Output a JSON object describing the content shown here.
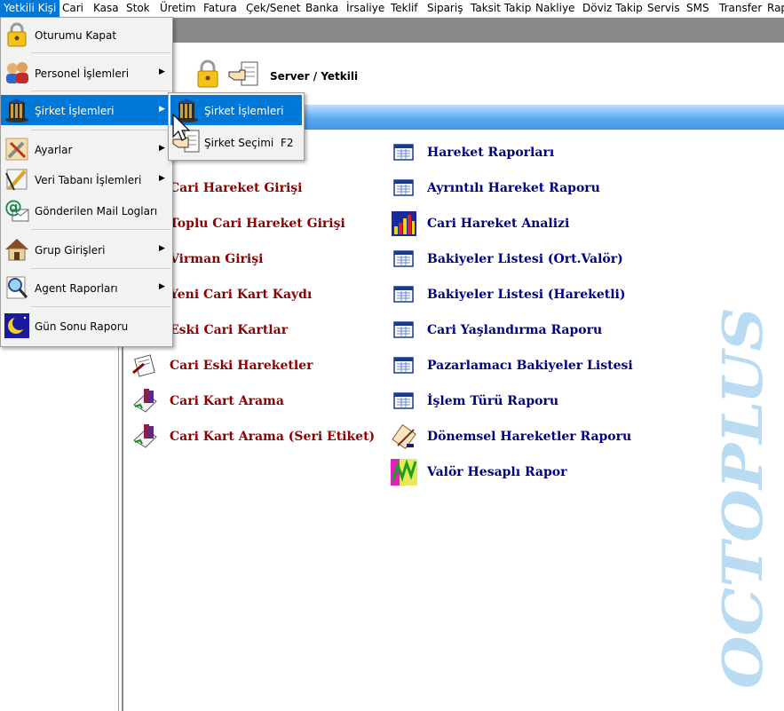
{
  "menubar": [
    {
      "label": "Yetkili Kişi",
      "active": true
    },
    {
      "label": "Cari"
    },
    {
      "label": "Kasa"
    },
    {
      "label": "Stok"
    },
    {
      "label": "Üretim"
    },
    {
      "label": "Fatura"
    },
    {
      "label": "Çek/Senet"
    },
    {
      "label": "Banka"
    },
    {
      "label": "İrsaliye"
    },
    {
      "label": "Teklif"
    },
    {
      "label": "Sipariş"
    },
    {
      "label": "Taksit Takip"
    },
    {
      "label": "Nakliye"
    },
    {
      "label": "Döviz Takip"
    },
    {
      "label": "Servis"
    },
    {
      "label": "SMS"
    },
    {
      "label": "Transfer"
    },
    {
      "label": "Rap"
    }
  ],
  "toolbar": {
    "server_text": "Server  /  Yetkili"
  },
  "dropdown": [
    {
      "label": "Oturumu Kapat",
      "icon": "lock-icon",
      "submenu": false
    },
    {
      "label": "Personel İşlemleri",
      "icon": "people-icon",
      "submenu": true
    },
    {
      "label": "Şirket İşlemleri",
      "icon": "building-icon",
      "submenu": true,
      "highlighted": true
    },
    {
      "label": "Ayarlar",
      "icon": "tools-icon",
      "submenu": true
    },
    {
      "label": "Veri Tabanı İşlemleri",
      "icon": "pencil-ruler-icon",
      "submenu": true
    },
    {
      "label": "Gönderilen Mail Logları",
      "icon": "mail-at-icon",
      "submenu": false
    },
    {
      "label": "Grup Girişleri",
      "icon": "house-icon",
      "submenu": true
    },
    {
      "label": "Agent Raporları",
      "icon": "magnifier-icon",
      "submenu": true
    },
    {
      "label": "Gün Sonu Raporu",
      "icon": "moon-icon",
      "submenu": false
    }
  ],
  "submenu": [
    {
      "label": "Şirket İşlemleri",
      "icon": "building-icon",
      "shortcut": "",
      "highlighted": true
    },
    {
      "label": "Şirket Seçimi",
      "icon": "hand-pointer-icon",
      "shortcut": "F2"
    }
  ],
  "left_links": [
    "Cari Hareket Girişi",
    "Toplu Cari Hareket Girişi",
    "Virman Girişi",
    "Yeni Cari Kart Kaydı",
    "Eski Cari Kartlar",
    "Cari Eski Hareketler",
    "Cari Kart Arama",
    "Cari Kart Arama (Seri Etiket)"
  ],
  "right_links": [
    "Hareket Raporları",
    "Ayrıntılı Hareket Raporu",
    "Cari Hareket Analizi",
    "Bakiyeler Listesi (Ort.Valör)",
    "Bakiyeler Listesi (Hareketli)",
    "Cari Yaşlandırma Raporu",
    "Pazarlamacı Bakiyeler Listesi",
    "İşlem Türü Raporu",
    "Dönemsel Hareketler Raporu",
    "Valör Hesaplı Rapor"
  ],
  "watermark": "OCTOPLUS",
  "colors": {
    "accent": "#0078d7",
    "link_red": "#8b0000",
    "link_blue": "#000080"
  }
}
